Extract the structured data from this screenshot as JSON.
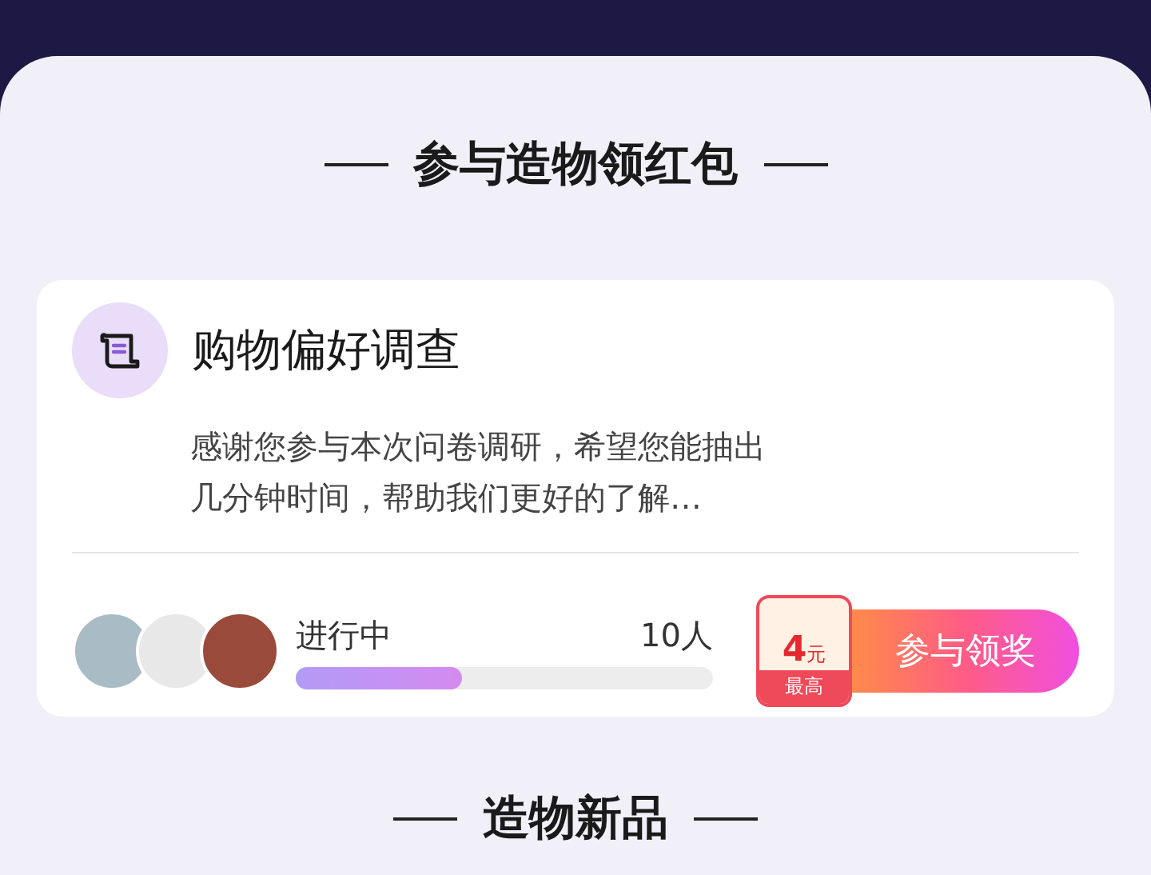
{
  "section_title": "参与造物领红包",
  "survey": {
    "title": "购物偏好调查",
    "description": "感谢您参与本次问卷调研，希望您能抽出几分钟时间，帮助我们更好的了解…",
    "status": "进行中",
    "participants": "10人",
    "level": 0.4,
    "reward": {
      "amount": "4",
      "unit": "元",
      "caption": "最高"
    },
    "button": "参与领奖"
  },
  "next_section_title": "造物新品"
}
